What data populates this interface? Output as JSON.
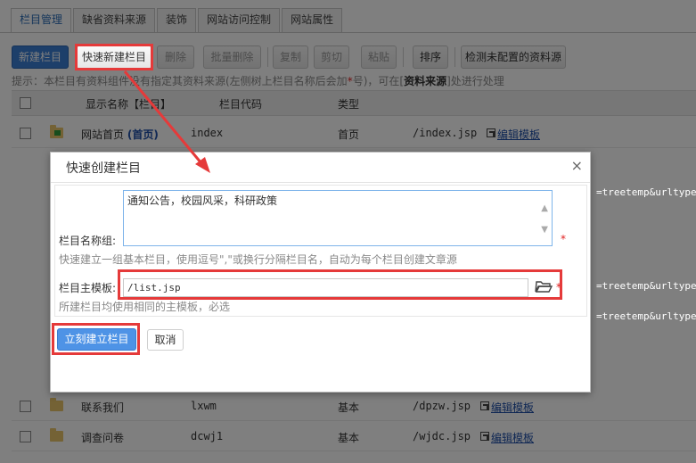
{
  "tabs": [
    "栏目管理",
    "缺省资料来源",
    "装饰",
    "网站访问控制",
    "网站属性"
  ],
  "toolbar": {
    "new_column": "新建栏目",
    "quick_new": "快速新建栏目",
    "delete": "删除",
    "batch_delete": "批量删除",
    "copy": "复制",
    "cut": "剪切",
    "paste": "粘贴",
    "sort": "排序",
    "detect": "检测未配置的资料源"
  },
  "hint": {
    "prefix": "提示：本栏目有资料组件没有指定其资料来源(左侧树上栏目名称后会加",
    "star": "*",
    "middle": "号)，可在[",
    "bold": "资料来源",
    "suffix": "]处进行处理"
  },
  "table": {
    "headers": {
      "name": "显示名称【栏目】",
      "code": "栏目代码",
      "type": "类型"
    },
    "rows": [
      {
        "name": "网站首页",
        "home_tag": "(首页)",
        "code": "index",
        "type": "首页",
        "path": "/index.jsp",
        "edit": "编辑模板"
      },
      {
        "name": "联系我们",
        "code": "lxwm",
        "type": "基本",
        "path": "/dpzw.jsp",
        "edit": "编辑模板"
      },
      {
        "name": "调查问卷",
        "code": "dcwj1",
        "type": "基本",
        "path": "/wjdc.jsp",
        "edit": "编辑模板"
      }
    ],
    "url_fragment": "=treetemp&urltype=t"
  },
  "dialog": {
    "title": "快速创建栏目",
    "close": "×",
    "group_label": "栏目名称组:",
    "group_value": "通知公告，校园风采，科研政策",
    "group_desc": "快速建立一组基本栏目，使用逗号\",\"或换行分隔栏目名，自动为每个栏目创建文章源",
    "template_label": "栏目主模板:",
    "template_value": "/list.jsp",
    "template_desc": "所建栏目均使用相同的主模板，必选",
    "required": "*",
    "create_button": "立刻建立栏目",
    "cancel_button": "取消"
  },
  "colors": {
    "primary": "#3b7fd4",
    "highlight": "#e53a3a",
    "link": "#1e4fa8"
  }
}
